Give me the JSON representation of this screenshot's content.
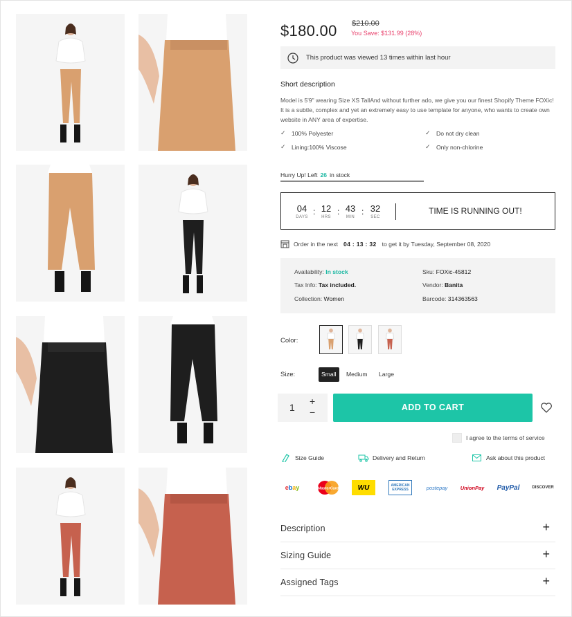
{
  "product": {
    "price": "$180.00",
    "old_price": "$210.00",
    "save_text": "You Save: $131.99 (28%)",
    "viewed_text": "This product was viewed 13 times within last hour",
    "short_desc_title": "Short description",
    "short_desc_text": "Model is 5'9\" wearing Size XS TallAnd without further ado, we give you our finest Shopify Theme FOXic! It is a subtle, complex and yet an extremely easy to use template for anyone, who wants to create own website in ANY area of expertise.",
    "features": [
      "100% Polyester",
      "Do not dry clean",
      "Lining:100% Viscose",
      "Only non-chlorine"
    ]
  },
  "stock": {
    "prefix": "Hurry Up! Left",
    "count": "26",
    "suffix": "in stock",
    "bar_fill_fraction": 1.0
  },
  "countdown": {
    "days": "04",
    "days_unit": "DAYS",
    "hrs": "12",
    "hrs_unit": "HRS",
    "min": "43",
    "min_unit": "MIN",
    "sec": "32",
    "sec_unit": "SEC",
    "message": "TIME IS RUNNING OUT!"
  },
  "delivery": {
    "prefix": "Order in the next",
    "time": "04 : 13 : 32",
    "suffix": "to get it by Tuesday, September 08, 2020"
  },
  "specs": {
    "availability_label": "Availability:",
    "availability_value": "In stock",
    "sku_label": "Sku:",
    "sku_value": "FOXic-45812",
    "tax_label": "Tax Info:",
    "tax_value": "Tax included.",
    "vendor_label": "Vendor:",
    "vendor_value": "Banita",
    "collection_label": "Collection:",
    "collection_value": "Women",
    "barcode_label": "Barcode:",
    "barcode_value": "314363563"
  },
  "options": {
    "color_label": "Color:",
    "size_label": "Size:",
    "sizes": [
      "Small",
      "Medium",
      "Large"
    ],
    "selected_size": "Small"
  },
  "cart": {
    "quantity": "1",
    "plus": "+",
    "minus": "−",
    "add_to_cart": "ADD TO CART",
    "terms": "I agree to the terms of service"
  },
  "links": {
    "size_guide": "Size Guide",
    "delivery_return": "Delivery and Return",
    "ask": "Ask about this product"
  },
  "payments": {
    "ebay": "ebay",
    "mastercard": "MasterCard",
    "wu": "WU",
    "amex": "AMERICAN EXPRESS",
    "postepay": "postepay",
    "unionpay": "UnionPay",
    "paypal": "PayPal",
    "discover": "DISCOVER"
  },
  "accordion": [
    "Description",
    "Sizing Guide",
    "Assigned Tags"
  ],
  "colors": {
    "accent": "#1dc5a7",
    "sale": "#e83e6a",
    "pants_tan": "#d9a06f",
    "pants_black": "#1e1e1e",
    "pants_red": "#c6614e"
  }
}
